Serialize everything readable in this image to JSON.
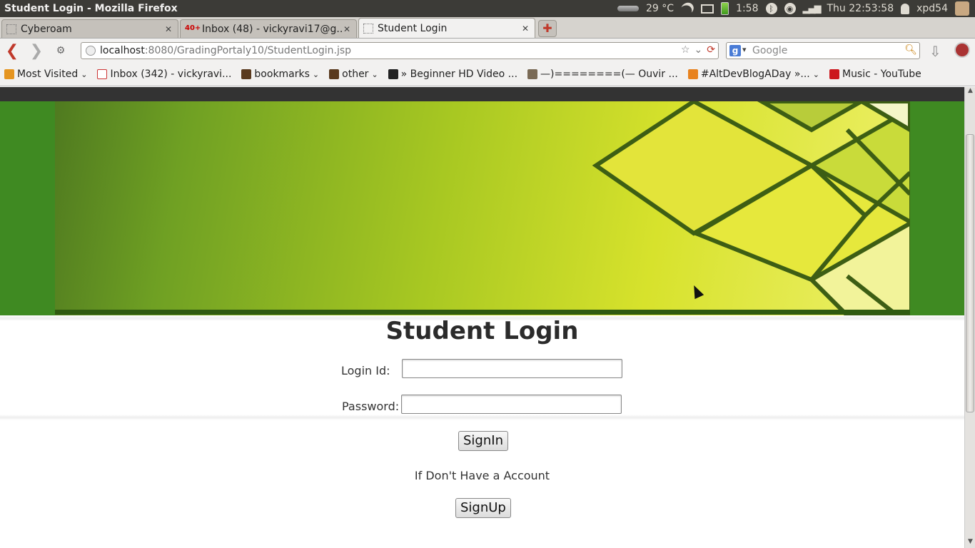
{
  "system": {
    "window_title": "Student Login - Mozilla Firefox",
    "temperature": "29 °C",
    "battery_time": "1:58",
    "clock": "Thu 22:53:58",
    "user": "xpd54"
  },
  "tabs": [
    {
      "label": "Cyberoam",
      "favicon": "blank-page-icon"
    },
    {
      "label": "Inbox (48) - vickyravi17@g...",
      "favicon": "gmail-icon",
      "badge": "40+"
    },
    {
      "label": "Student Login",
      "favicon": "blank-page-icon",
      "active": true
    }
  ],
  "nav": {
    "url_host": "localhost",
    "url_path": ":8080/GradingPortaly10/StudentLogin.jsp",
    "search_placeholder": "Google"
  },
  "bookmarks": [
    {
      "label": "Most Visited",
      "dropdown": true,
      "icon": "most-visited-icon"
    },
    {
      "label": "Inbox (342) - vickyravi...",
      "dropdown": false,
      "icon": "gmail-icon"
    },
    {
      "label": "bookmarks",
      "dropdown": true,
      "icon": "folder-icon"
    },
    {
      "label": "other",
      "dropdown": true,
      "icon": "folder-icon"
    },
    {
      "label": "» Beginner HD Video ...",
      "dropdown": false,
      "icon": "video-icon"
    },
    {
      "label": "—)========(— Ouvir ...",
      "dropdown": false,
      "icon": "page-icon"
    },
    {
      "label": "#AltDevBlogADay »...",
      "dropdown": true,
      "icon": "rss-icon"
    },
    {
      "label": "Music - YouTube",
      "dropdown": false,
      "icon": "youtube-icon"
    }
  ],
  "page": {
    "title": "Student Login",
    "login_label": "Login Id:",
    "password_label": "Password:",
    "signin_label": "SignIn",
    "account_hint": "If Don't Have a Account",
    "signup_label": "SignUp"
  }
}
